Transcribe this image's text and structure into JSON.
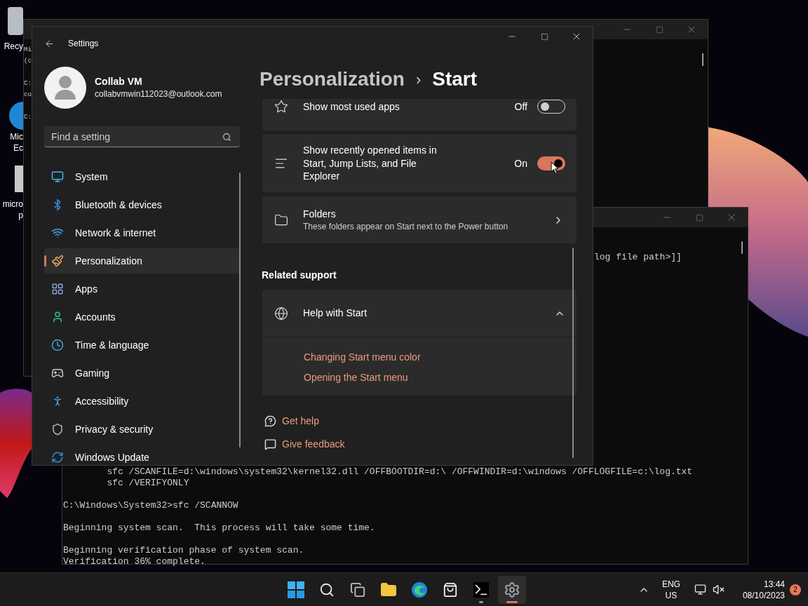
{
  "desktop_icons": [
    {
      "label_lines": [
        "Recy"
      ]
    },
    {
      "label_lines": [
        "Mic",
        "Ec"
      ]
    },
    {
      "label_lines": [
        "micro",
        "p"
      ]
    }
  ],
  "back_console": {
    "paragraphs": [
      [
        "Mi",
        "(c"
      ],
      [
        "C:",
        "cu"
      ],
      [
        "C:"
      ]
    ]
  },
  "front_console": {
    "top_line": "log file path>]]",
    "paragraphs": [
      [
        "        sfc /SCANFILE=d:\\windows\\system32\\kernel32.dll /OFFBOOTDIR=d:\\ /OFFWINDIR=d:\\windows /OFFLOGFILE=c:\\log.txt",
        "        sfc /VERIFYONLY"
      ],
      [
        "C:\\Windows\\System32>sfc /SCANNOW"
      ],
      [
        "Beginning system scan.  This process will take some time."
      ],
      [
        "Beginning verification phase of system scan.",
        "Verification 36% complete."
      ]
    ]
  },
  "settings": {
    "title": "Settings",
    "user": {
      "name": "Collab VM",
      "email": "collabvmwin112023@outlook.com"
    },
    "search": {
      "placeholder": "Find a setting"
    },
    "nav": [
      {
        "label": "System",
        "selected": false
      },
      {
        "label": "Bluetooth & devices",
        "selected": false
      },
      {
        "label": "Network & internet",
        "selected": false
      },
      {
        "label": "Personalization",
        "selected": true
      },
      {
        "label": "Apps",
        "selected": false
      },
      {
        "label": "Accounts",
        "selected": false
      },
      {
        "label": "Time & language",
        "selected": false
      },
      {
        "label": "Gaming",
        "selected": false
      },
      {
        "label": "Accessibility",
        "selected": false
      },
      {
        "label": "Privacy & security",
        "selected": false
      },
      {
        "label": "Windows Update",
        "selected": false
      }
    ],
    "breadcrumb": {
      "parent": "Personalization",
      "separator": "›",
      "current": "Start"
    },
    "cards": [
      {
        "kind": "toggle",
        "label_lines": [
          "Show most used apps"
        ],
        "state_label": "Off",
        "on": false
      },
      {
        "kind": "toggle",
        "label_lines": [
          "Show recently opened items in",
          "Start, Jump Lists, and File",
          "Explorer"
        ],
        "state_label": "On",
        "on": true
      },
      {
        "kind": "link",
        "label_lines": [
          "Folders"
        ],
        "description": "These folders appear on Start next to the Power button"
      }
    ],
    "related_support": {
      "heading": "Related support",
      "title": "Help with Start",
      "expanded": true,
      "links": [
        "Changing Start menu color",
        "Opening the Start menu"
      ]
    },
    "footer_links": [
      {
        "kind": "help",
        "label": "Get help"
      },
      {
        "kind": "feedback",
        "label": "Give feedback"
      }
    ]
  },
  "taskbar": {
    "apps": [
      {
        "selected": false,
        "running": false
      },
      {
        "selected": false,
        "running": false
      },
      {
        "selected": false,
        "running": false
      },
      {
        "selected": false,
        "running": false
      },
      {
        "selected": false,
        "running": false
      },
      {
        "selected": false,
        "running": false
      },
      {
        "selected": false,
        "running": true
      },
      {
        "selected": true,
        "running": true
      }
    ],
    "language": [
      "ENG",
      "US"
    ],
    "time": "13:44",
    "date": "08/10/2023",
    "notification_count": "2"
  }
}
